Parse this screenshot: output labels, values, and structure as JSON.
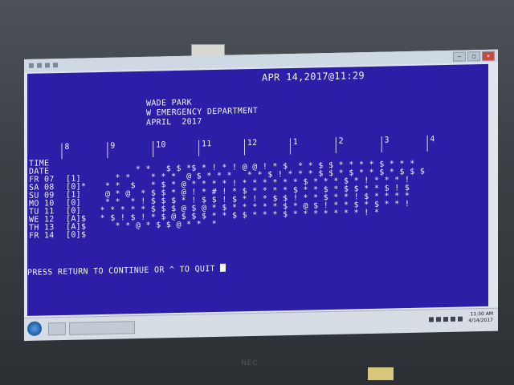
{
  "terminal": {
    "timestamp": "APR 14,2017@11:29",
    "title_lines": [
      "WADE PARK",
      "W EMERGENCY DEPARTMENT",
      "APRIL  2017"
    ],
    "hour_marks": [
      "8",
      "9",
      "10",
      "11",
      "12",
      "1",
      "2",
      "3",
      "4"
    ],
    "row_labels": [
      "TIME",
      "DATE",
      "FR 07",
      "SA 08",
      "SU 09",
      "MO 10",
      "TU 11",
      "WE 12",
      "TH 13",
      "FR 14"
    ],
    "row_flags": [
      "",
      "",
      "[1]",
      "[0]*",
      "[1]",
      "[0]",
      "[0]",
      "[A]$",
      "[A]$",
      "[0]$"
    ],
    "grid_rows": [
      "|8       |9       |10      |11      |12      |1       |2       |3       |4",
      "|        |        |        |        |        |        |        |        |",
      "         * *   $ $ *$ * ! * ! @ @ ! * $  * * $ $ * * * * $ * * *",
      "     * *    * * *  @ $ * * *   * * $ ! * * * $ $ * $ * * $ * $ $ $",
      "   * *  $   * $ * @ * * * * ! * * * * * * $ * * * $ * ! * * * !",
      "   @ * @  * $ $ * @ ! * # ! * $ * * * * $ * * $ * $ $ * * $ ! $",
      "   * *  * ! $ $ $ * ! $ $ ! $ * ! * $ $ ! * * $ * * ! $ * * * *",
      "  * * * * * $ $ $ @ $ @ * $ * * * * * $ * @ $ ! * * $ * $ * * !",
      "  * $ ! $ ! * $ @ $ $ $ * * $ $ * * * $ * * * * * * * ! *",
      "     * * @ * $ $ @ * *  *"
    ],
    "prompt": "PRESS RETURN TO CONTINUE OR ^ TO QUIT"
  },
  "taskbar": {
    "time": "11:30 AM",
    "date": "4/14/2017"
  },
  "monitor": {
    "brand": "NEC"
  },
  "colors": {
    "terminal_bg": "#2b1fa8",
    "terminal_fg": "#f2f2f2"
  }
}
